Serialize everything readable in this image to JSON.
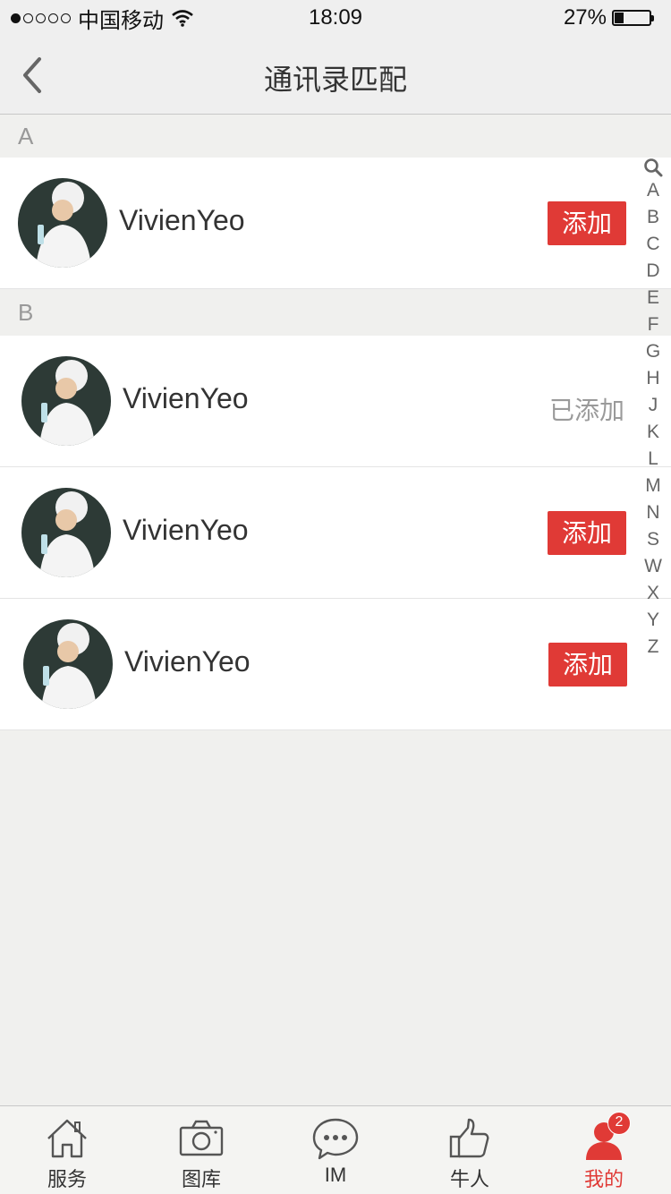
{
  "status_bar": {
    "carrier": "中国移动",
    "time": "18:09",
    "battery_text": "27%",
    "battery_level": 0.27
  },
  "nav": {
    "title": "通讯录匹配"
  },
  "sections": [
    {
      "letter": "A",
      "contacts": [
        {
          "name": "VivienYeo",
          "action": "添加",
          "added": false
        }
      ]
    },
    {
      "letter": "B",
      "contacts": [
        {
          "name": "VivienYeo",
          "action": "已添加",
          "added": true
        },
        {
          "name": "VivienYeo",
          "action": "添加",
          "added": false
        },
        {
          "name": "VivienYeo",
          "action": "添加",
          "added": false
        }
      ]
    }
  ],
  "index_letters": [
    "A",
    "B",
    "C",
    "D",
    "E",
    "F",
    "G",
    "H",
    "J",
    "K",
    "L",
    "M",
    "N",
    "S",
    "W",
    "X",
    "Y",
    "Z"
  ],
  "tabs": [
    {
      "label": "服务",
      "icon": "home-icon"
    },
    {
      "label": "图库",
      "icon": "camera-icon"
    },
    {
      "label": "IM",
      "icon": "chat-icon"
    },
    {
      "label": "牛人",
      "icon": "thumbs-up-icon"
    },
    {
      "label": "我的",
      "icon": "user-icon",
      "active": true,
      "badge": "2"
    }
  ],
  "colors": {
    "accent": "#e03a36",
    "background": "#f0f0ee"
  }
}
